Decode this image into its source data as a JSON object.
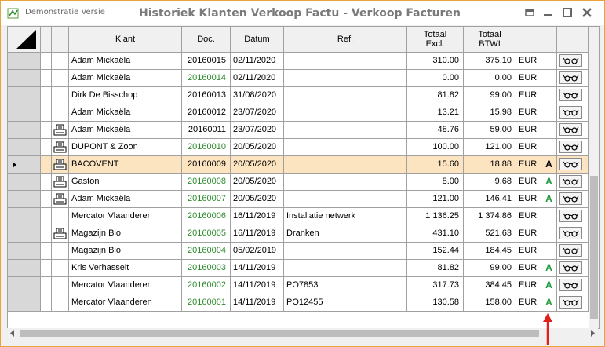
{
  "window": {
    "demo_label": "Demonstratie Versie",
    "title": "Historiek Klanten Verkoop Factu - Verkoop Facturen"
  },
  "columns": {
    "klant": "Klant",
    "doc": "Doc.",
    "datum": "Datum",
    "ref": "Ref.",
    "totaal_excl_1": "Totaal",
    "totaal_excl_2": "Excl.",
    "totaal_btwi_1": "Totaal",
    "totaal_btwi_2": "BTWI"
  },
  "rows": [
    {
      "klant": "Adam Mickaëla",
      "doc": "20160015",
      "doc_green": false,
      "datum": "02/11/2020",
      "ref": "",
      "excl": "310.00",
      "btwi": "375.10",
      "cur": "EUR",
      "badge": "",
      "printed": false,
      "selected": false
    },
    {
      "klant": "Adam Mickaëla",
      "doc": "20160014",
      "doc_green": true,
      "datum": "02/11/2020",
      "ref": "",
      "excl": "0.00",
      "btwi": "0.00",
      "cur": "EUR",
      "badge": "",
      "printed": false,
      "selected": false
    },
    {
      "klant": "Dirk De Bisschop",
      "doc": "20160013",
      "doc_green": false,
      "datum": "31/08/2020",
      "ref": "",
      "excl": "81.82",
      "btwi": "99.00",
      "cur": "EUR",
      "badge": "",
      "printed": false,
      "selected": false
    },
    {
      "klant": "Adam Mickaëla",
      "doc": "20160012",
      "doc_green": false,
      "datum": "23/07/2020",
      "ref": "",
      "excl": "13.21",
      "btwi": "15.98",
      "cur": "EUR",
      "badge": "",
      "printed": false,
      "selected": false
    },
    {
      "klant": "Adam Mickaëla",
      "doc": "20160011",
      "doc_green": false,
      "datum": "23/07/2020",
      "ref": "",
      "excl": "48.76",
      "btwi": "59.00",
      "cur": "EUR",
      "badge": "",
      "printed": true,
      "selected": false
    },
    {
      "klant": "DUPONT & Zoon",
      "doc": "20160010",
      "doc_green": true,
      "datum": "20/05/2020",
      "ref": "",
      "excl": "100.00",
      "btwi": "121.00",
      "cur": "EUR",
      "badge": "",
      "printed": true,
      "selected": false
    },
    {
      "klant": "BACOVENT",
      "doc": "20160009",
      "doc_green": false,
      "datum": "20/05/2020",
      "ref": "",
      "excl": "15.60",
      "btwi": "18.88",
      "cur": "EUR",
      "badge": "A",
      "printed": true,
      "selected": true
    },
    {
      "klant": "Gaston",
      "doc": "20160008",
      "doc_green": true,
      "datum": "20/05/2020",
      "ref": "",
      "excl": "8.00",
      "btwi": "9.68",
      "cur": "EUR",
      "badge": "A",
      "printed": true,
      "selected": false
    },
    {
      "klant": "Adam Mickaëla",
      "doc": "20160007",
      "doc_green": true,
      "datum": "20/05/2020",
      "ref": "",
      "excl": "121.00",
      "btwi": "146.41",
      "cur": "EUR",
      "badge": "A",
      "printed": true,
      "selected": false
    },
    {
      "klant": "Mercator Vlaanderen",
      "doc": "20160006",
      "doc_green": true,
      "datum": "16/11/2019",
      "ref": "Installatie netwerk",
      "excl": "1 136.25",
      "btwi": "1 374.86",
      "cur": "EUR",
      "badge": "",
      "printed": false,
      "selected": false
    },
    {
      "klant": "Magazijn Bio",
      "doc": "20160005",
      "doc_green": true,
      "datum": "16/11/2019",
      "ref": "Dranken",
      "excl": "431.10",
      "btwi": "521.63",
      "cur": "EUR",
      "badge": "",
      "printed": true,
      "selected": false
    },
    {
      "klant": "Magazijn Bio",
      "doc": "20160004",
      "doc_green": true,
      "datum": "05/02/2019",
      "ref": "",
      "excl": "152.44",
      "btwi": "184.45",
      "cur": "EUR",
      "badge": "",
      "printed": false,
      "selected": false
    },
    {
      "klant": "Kris Verhasselt",
      "doc": "20160003",
      "doc_green": true,
      "datum": "14/11/2019",
      "ref": "",
      "excl": "81.82",
      "btwi": "99.00",
      "cur": "EUR",
      "badge": "A",
      "printed": false,
      "selected": false
    },
    {
      "klant": "Mercator Vlaanderen",
      "doc": "20160002",
      "doc_green": true,
      "datum": "14/11/2019",
      "ref": "PO7853",
      "excl": "317.73",
      "btwi": "384.45",
      "cur": "EUR",
      "badge": "A",
      "printed": false,
      "selected": false
    },
    {
      "klant": "Mercator Vlaanderen",
      "doc": "20160001",
      "doc_green": true,
      "datum": "14/11/2019",
      "ref": "PO12455",
      "excl": "130.58",
      "btwi": "158.00",
      "cur": "EUR",
      "badge": "A",
      "printed": false,
      "selected": false
    }
  ],
  "colors": {
    "accent_border": "#e8a33a",
    "selected_row": "#fde4c0",
    "doc_green": "#2e8b2e",
    "badge_green": "#1f9a3a",
    "arrow_red": "#e0201c"
  },
  "icons": {
    "app": "app-icon",
    "view_button": "glasses-icon",
    "printed": "printer-icon",
    "current_row": "row-pointer-icon",
    "annotation": "red-arrow-icon"
  }
}
